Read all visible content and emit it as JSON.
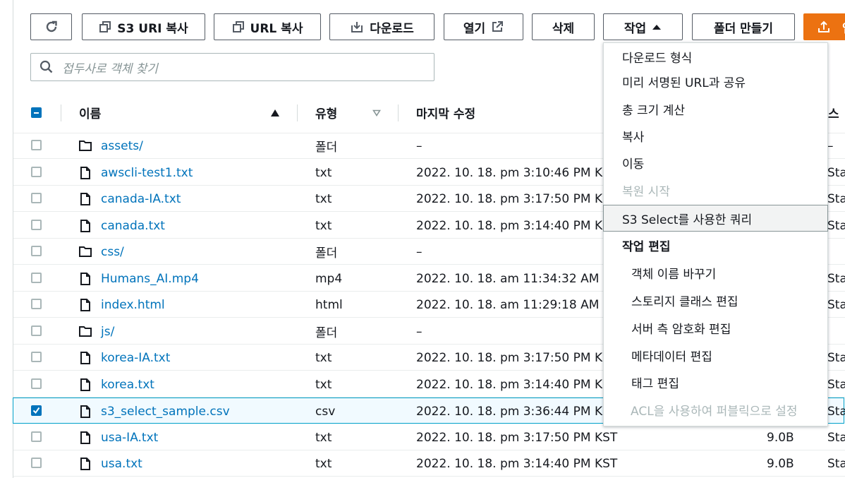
{
  "toolbar": {
    "refresh_label": "",
    "copy_s3_uri": "S3 URI 복사",
    "copy_url": "URL 복사",
    "download": "다운로드",
    "open": "열기",
    "delete": "삭제",
    "actions": "작업",
    "create_folder": "폴더 만들기",
    "upload": "업"
  },
  "search": {
    "placeholder": "접두사로 객체 찾기"
  },
  "table": {
    "columns": {
      "name": "이름",
      "type": "유형",
      "modified": "마지막 수정",
      "storage_partial": "스"
    },
    "rows": [
      {
        "name": "assets/",
        "kind": "folder",
        "type": "폴더",
        "modified": "–",
        "size": "",
        "storage": "–",
        "checked": false
      },
      {
        "name": "awscli-test1.txt",
        "kind": "file",
        "type": "txt",
        "modified": "2022. 10. 18. pm 3:10:46 PM KST",
        "size": "",
        "storage": "Sta",
        "checked": false
      },
      {
        "name": "canada-IA.txt",
        "kind": "file",
        "type": "txt",
        "modified": "2022. 10. 18. pm 3:17:50 PM KST",
        "size": "",
        "storage": "Sta",
        "checked": false
      },
      {
        "name": "canada.txt",
        "kind": "file",
        "type": "txt",
        "modified": "2022. 10. 18. pm 3:14:40 PM KST",
        "size": "",
        "storage": "Sta",
        "checked": false
      },
      {
        "name": "css/",
        "kind": "folder",
        "type": "폴더",
        "modified": "–",
        "size": "",
        "storage": "",
        "checked": false
      },
      {
        "name": "Humans_AI.mp4",
        "kind": "file",
        "type": "mp4",
        "modified": "2022. 10. 18. am 11:34:32 AM KST",
        "size": "",
        "storage": "Sta",
        "checked": false
      },
      {
        "name": "index.html",
        "kind": "file",
        "type": "html",
        "modified": "2022. 10. 18. am 11:29:18 AM KST",
        "size": "",
        "storage": "Sta",
        "checked": false
      },
      {
        "name": "js/",
        "kind": "folder",
        "type": "폴더",
        "modified": "–",
        "size": "",
        "storage": "",
        "checked": false
      },
      {
        "name": "korea-IA.txt",
        "kind": "file",
        "type": "txt",
        "modified": "2022. 10. 18. pm 3:17:50 PM KST",
        "size": "",
        "storage": "Sta",
        "checked": false
      },
      {
        "name": "korea.txt",
        "kind": "file",
        "type": "txt",
        "modified": "2022. 10. 18. pm 3:14:40 PM KST",
        "size": "",
        "storage": "Sta",
        "checked": false
      },
      {
        "name": "s3_select_sample.csv",
        "kind": "file",
        "type": "csv",
        "modified": "2022. 10. 18. pm 3:36:44 PM KST",
        "size": "",
        "storage": "Sta",
        "checked": true
      },
      {
        "name": "usa-IA.txt",
        "kind": "file",
        "type": "txt",
        "modified": "2022. 10. 18. pm 3:17:50 PM KST",
        "size": "9.0B",
        "storage": "Sta",
        "checked": false
      },
      {
        "name": "usa.txt",
        "kind": "file",
        "type": "txt",
        "modified": "2022. 10. 18. pm 3:14:40 PM KST",
        "size": "9.0B",
        "storage": "Sta",
        "checked": false
      }
    ]
  },
  "actions_menu": {
    "items": [
      {
        "label": "다운로드 형식",
        "state": "normal"
      },
      {
        "label": "미리 서명된 URL과 공유",
        "state": "normal"
      },
      {
        "label": "총 크기 계산",
        "state": "normal"
      },
      {
        "label": "복사",
        "state": "normal"
      },
      {
        "label": "이동",
        "state": "normal"
      },
      {
        "label": "복원 시작",
        "state": "disabled"
      },
      {
        "label": "S3 Select를 사용한 쿼리",
        "state": "highlight"
      },
      {
        "label": "작업 편집",
        "state": "group"
      },
      {
        "label": "객체 이름 바꾸기",
        "state": "sub"
      },
      {
        "label": "스토리지 클래스 편집",
        "state": "sub"
      },
      {
        "label": "서버 측 암호화 편집",
        "state": "sub"
      },
      {
        "label": "메타데이터 편집",
        "state": "sub"
      },
      {
        "label": "태그 편집",
        "state": "sub"
      },
      {
        "label": "ACL을 사용하여 퍼블릭으로 설정",
        "state": "disabled-sub"
      }
    ]
  },
  "colors": {
    "link": "#0073bb",
    "primary": "#ec7211",
    "border": "#545b64",
    "selected_row": "#f1faff"
  }
}
